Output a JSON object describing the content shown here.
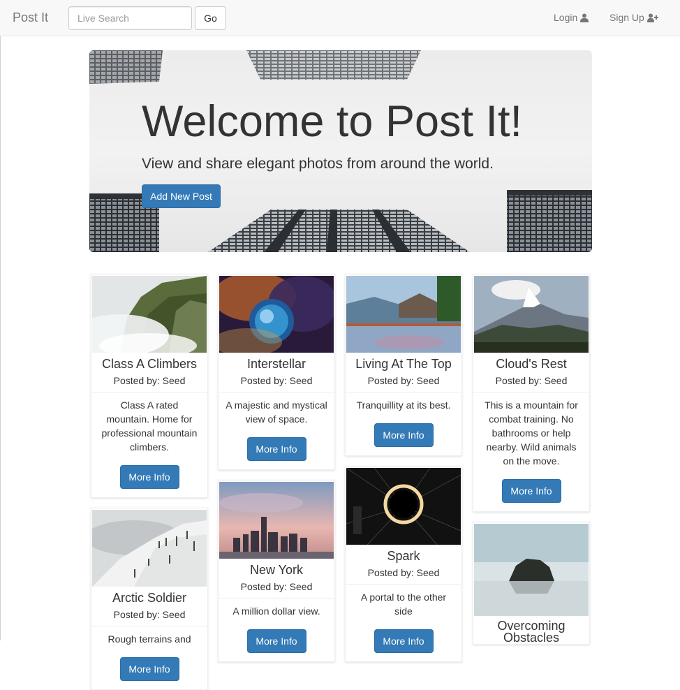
{
  "navbar": {
    "brand": "Post It",
    "search_placeholder": "Live Search",
    "go_label": "Go",
    "login_label": "Login",
    "signup_label": "Sign Up"
  },
  "hero": {
    "title": "Welcome to Post It!",
    "subtitle": "View and share elegant photos from around the world.",
    "button_label": "Add New Post"
  },
  "posts": [
    {
      "title": "Class A Climbers",
      "poster": "Posted by: Seed",
      "desc": "Class A rated mountain. Home for professional mountain climbers.",
      "button": "More Info"
    },
    {
      "title": "Interstellar",
      "poster": "Posted by: Seed",
      "desc": "A majestic and mystical view of space.",
      "button": "More Info"
    },
    {
      "title": "Living At The Top",
      "poster": "Posted by: Seed",
      "desc": "Tranquillity at its best.",
      "button": "More Info"
    },
    {
      "title": "Cloud's Rest",
      "poster": "Posted by: Seed",
      "desc": "This is a mountain for combat training. No bathrooms or help nearby. Wild animals on the move.",
      "button": "More Info"
    },
    {
      "title": "Arctic Soldier",
      "poster": "Posted by: Seed",
      "desc": "Rough terrains and",
      "button": "More Info"
    },
    {
      "title": "New York",
      "poster": "Posted by: Seed",
      "desc": "A million dollar view.",
      "button": "More Info"
    },
    {
      "title": "Spark",
      "poster": "Posted by: Seed",
      "desc": "A portal to the other side",
      "button": "More Info"
    },
    {
      "title": "Overcoming Obstacles",
      "poster": "",
      "desc": "",
      "button": ""
    }
  ],
  "colors": {
    "primary": "#337ab7",
    "navbar_bg": "#f8f8f8",
    "nav_text": "#777777"
  },
  "icons": {
    "login": "user-icon",
    "signup": "user-plus-icon"
  }
}
